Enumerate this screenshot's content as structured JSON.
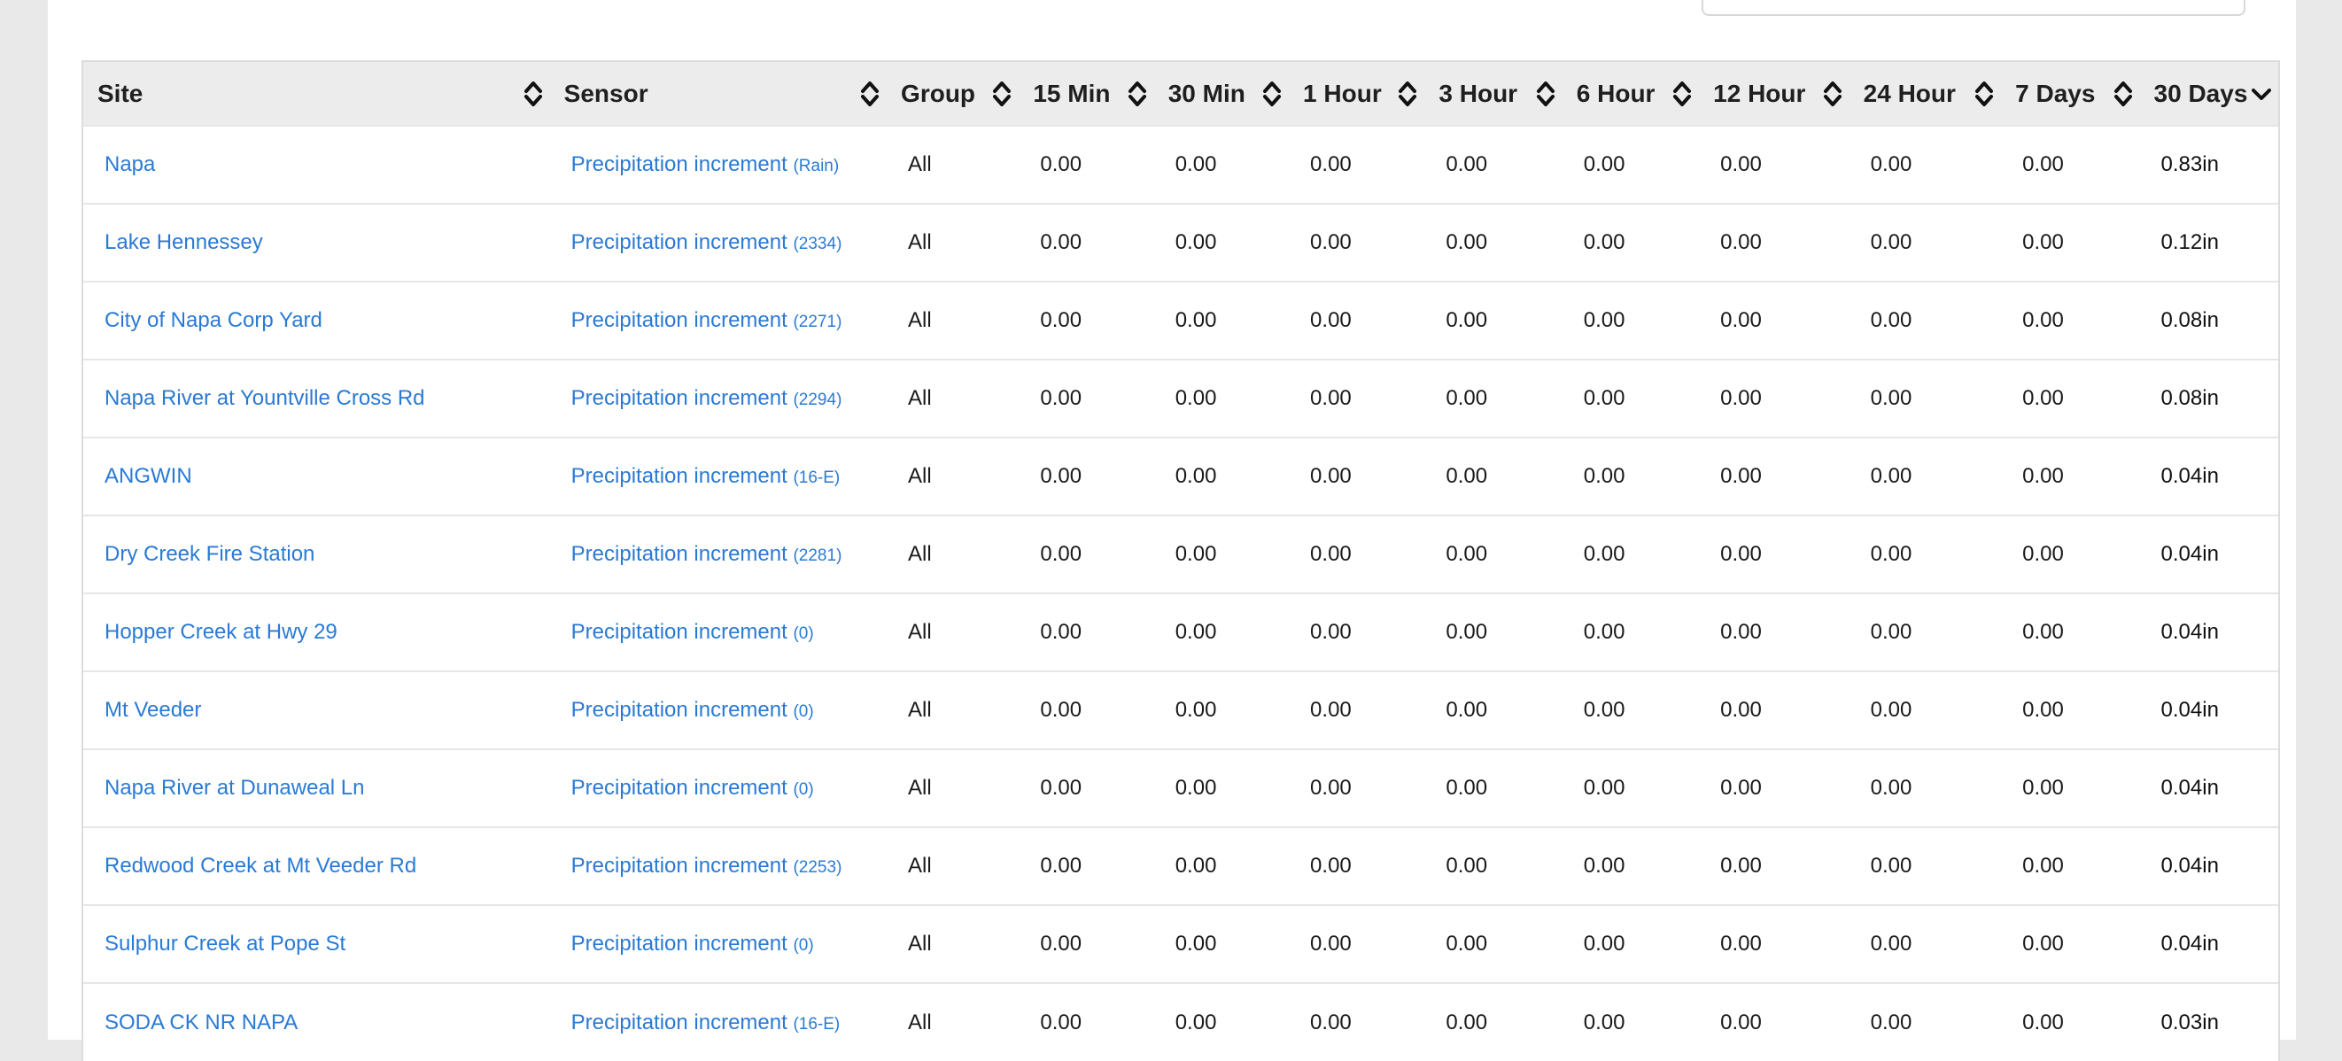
{
  "table": {
    "columns": [
      {
        "label": "Site",
        "sort": "none"
      },
      {
        "label": "Sensor",
        "sort": "none"
      },
      {
        "label": "Group",
        "sort": "none"
      },
      {
        "label": "15 Min",
        "sort": "none"
      },
      {
        "label": "30 Min",
        "sort": "none"
      },
      {
        "label": "1 Hour",
        "sort": "none"
      },
      {
        "label": "3 Hour",
        "sort": "none"
      },
      {
        "label": "6 Hour",
        "sort": "none"
      },
      {
        "label": "12 Hour",
        "sort": "none"
      },
      {
        "label": "24 Hour",
        "sort": "none"
      },
      {
        "label": "7 Days",
        "sort": "none"
      },
      {
        "label": "30 Days",
        "sort": "desc"
      }
    ],
    "rows": [
      {
        "site": "Napa",
        "sensor": "Precipitation increment",
        "code": "(Rain)",
        "group": "All",
        "values": [
          "0.00",
          "0.00",
          "0.00",
          "0.00",
          "0.00",
          "0.00",
          "0.00",
          "0.00"
        ],
        "total": "0.83in"
      },
      {
        "site": "Lake Hennessey",
        "sensor": "Precipitation increment",
        "code": "(2334)",
        "group": "All",
        "values": [
          "0.00",
          "0.00",
          "0.00",
          "0.00",
          "0.00",
          "0.00",
          "0.00",
          "0.00"
        ],
        "total": "0.12in"
      },
      {
        "site": "City of Napa Corp Yard",
        "sensor": "Precipitation increment",
        "code": "(2271)",
        "group": "All",
        "values": [
          "0.00",
          "0.00",
          "0.00",
          "0.00",
          "0.00",
          "0.00",
          "0.00",
          "0.00"
        ],
        "total": "0.08in"
      },
      {
        "site": "Napa River at Yountville Cross Rd",
        "sensor": "Precipitation increment",
        "code": "(2294)",
        "group": "All",
        "values": [
          "0.00",
          "0.00",
          "0.00",
          "0.00",
          "0.00",
          "0.00",
          "0.00",
          "0.00"
        ],
        "total": "0.08in"
      },
      {
        "site": "ANGWIN",
        "sensor": "Precipitation increment",
        "code": "(16-E)",
        "group": "All",
        "values": [
          "0.00",
          "0.00",
          "0.00",
          "0.00",
          "0.00",
          "0.00",
          "0.00",
          "0.00"
        ],
        "total": "0.04in"
      },
      {
        "site": "Dry Creek Fire Station",
        "sensor": "Precipitation increment",
        "code": "(2281)",
        "group": "All",
        "values": [
          "0.00",
          "0.00",
          "0.00",
          "0.00",
          "0.00",
          "0.00",
          "0.00",
          "0.00"
        ],
        "total": "0.04in"
      },
      {
        "site": "Hopper Creek at Hwy 29",
        "sensor": "Precipitation increment",
        "code": "(0)",
        "group": "All",
        "values": [
          "0.00",
          "0.00",
          "0.00",
          "0.00",
          "0.00",
          "0.00",
          "0.00",
          "0.00"
        ],
        "total": "0.04in"
      },
      {
        "site": "Mt Veeder",
        "sensor": "Precipitation increment",
        "code": "(0)",
        "group": "All",
        "values": [
          "0.00",
          "0.00",
          "0.00",
          "0.00",
          "0.00",
          "0.00",
          "0.00",
          "0.00"
        ],
        "total": "0.04in"
      },
      {
        "site": "Napa River at Dunaweal Ln",
        "sensor": "Precipitation increment",
        "code": "(0)",
        "group": "All",
        "values": [
          "0.00",
          "0.00",
          "0.00",
          "0.00",
          "0.00",
          "0.00",
          "0.00",
          "0.00"
        ],
        "total": "0.04in"
      },
      {
        "site": "Redwood Creek at Mt Veeder Rd",
        "sensor": "Precipitation increment",
        "code": "(2253)",
        "group": "All",
        "values": [
          "0.00",
          "0.00",
          "0.00",
          "0.00",
          "0.00",
          "0.00",
          "0.00",
          "0.00"
        ],
        "total": "0.04in"
      },
      {
        "site": "Sulphur Creek at Pope St",
        "sensor": "Precipitation increment",
        "code": "(0)",
        "group": "All",
        "values": [
          "0.00",
          "0.00",
          "0.00",
          "0.00",
          "0.00",
          "0.00",
          "0.00",
          "0.00"
        ],
        "total": "0.04in"
      },
      {
        "site": "SODA CK NR NAPA",
        "sensor": "Precipitation increment",
        "code": "(16-E)",
        "group": "All",
        "values": [
          "0.00",
          "0.00",
          "0.00",
          "0.00",
          "0.00",
          "0.00",
          "0.00",
          "0.00"
        ],
        "total": "0.03in"
      }
    ]
  },
  "colors": {
    "link": "#2a7ad4",
    "header_bg": "#ececec",
    "page_bg": "#e9e9e9"
  },
  "icons": {
    "sort": "sort-both-icon",
    "sorted_desc": "chevron-down-icon"
  }
}
